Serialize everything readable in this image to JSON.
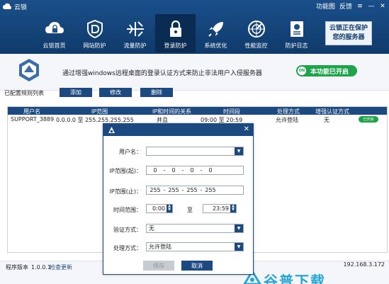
{
  "window": {
    "title": "云锁",
    "menu_features": "功能图",
    "menu_feedback": "反馈",
    "ctrl_menu": "≡",
    "ctrl_min": "—",
    "ctrl_close": "✕"
  },
  "nav": {
    "items": [
      {
        "label": "云锁首页",
        "icon": "cloud-lock-icon"
      },
      {
        "label": "网站防护",
        "icon": "shield-d-icon"
      },
      {
        "label": "流量防护",
        "icon": "traffic-icon"
      },
      {
        "label": "登录防护",
        "icon": "padlock-icon"
      },
      {
        "label": "系统优化",
        "icon": "rocket-icon"
      },
      {
        "label": "性能监控",
        "icon": "radar-icon"
      },
      {
        "label": "防护日志",
        "icon": "log-icon"
      }
    ],
    "active_index": 3,
    "status_box_line1": "云锁正在保护",
    "status_box_line2": "您的服务器"
  },
  "info": {
    "description": "通过增强windows远程桌面的登录认证方式来防止非法用户入侵服务器",
    "toggle_knob": "ON",
    "toggle_label": "本功能已开启",
    "rules_label": "已配置规则列表",
    "buttons": [
      "添加",
      "修改",
      "删除"
    ]
  },
  "table": {
    "headers": [
      "用户名",
      "IP范围",
      "IP和时间的关系",
      "时间段",
      "处理方式",
      "增强认证方式"
    ],
    "rows": [
      {
        "user": "SUPPORT_3889",
        "ip_range": "0.0.0.0 至 255.255.255.255",
        "relation": "并且",
        "time": "09:00 至 20:59",
        "action": "允许登陆",
        "auth": "无",
        "toggle": "已开启"
      }
    ]
  },
  "bottom": {
    "version_label": "程序版本",
    "version": "1.0.0.1",
    "check_update": "检查更新",
    "ip": "192.168.3.172",
    "watermark": "谷普下载"
  },
  "dialog": {
    "close": "✕",
    "username_label": "用户名：",
    "username_value": "",
    "ip_start_label": "IP范围(起)：",
    "ip_start": [
      "0",
      "0",
      "0",
      "0"
    ],
    "ip_end_label": "IP范围(止)：",
    "ip_end": [
      "255",
      "255",
      "255",
      "255"
    ],
    "time_label": "时间范围：",
    "time_start": "0:00",
    "time_sep": "至",
    "time_end": "23:59",
    "auth_label": "验证方式：",
    "auth_value": "无",
    "action_label": "处理方式：",
    "action_value": "允许登陆",
    "save_label": "保存",
    "cancel_label": "取消"
  }
}
